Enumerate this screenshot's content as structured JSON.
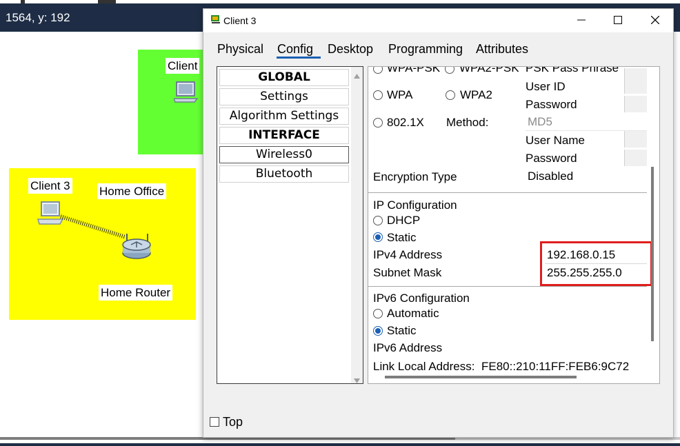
{
  "workspace": {
    "coords": "1564, y: 192",
    "labels": {
      "client_partial": "Client",
      "client3": "Client 3",
      "home_office": "Home Office",
      "home_router": "Home Router"
    },
    "colors": {
      "green_area": "#64ff33",
      "yellow_area": "#ffff00",
      "topbar": "#1e2d45"
    }
  },
  "dialog": {
    "title": "Client 3",
    "window_buttons": [
      "minimize-icon",
      "maximize-icon",
      "close-icon"
    ],
    "tabs": [
      {
        "label": "Physical",
        "active": false
      },
      {
        "label": "Config",
        "active": true
      },
      {
        "label": "Desktop",
        "active": false
      },
      {
        "label": "Programming",
        "active": false
      },
      {
        "label": "Attributes",
        "active": false
      }
    ],
    "nav": [
      {
        "label": "GLOBAL",
        "header": true
      },
      {
        "label": "Settings",
        "header": false
      },
      {
        "label": "Algorithm Settings",
        "header": false
      },
      {
        "label": "INTERFACE",
        "header": true
      },
      {
        "label": "Wireless0",
        "header": false,
        "selected": true
      },
      {
        "label": "Bluetooth",
        "header": false
      }
    ],
    "auth": {
      "wpa_psk": "WPA-PSK",
      "wpa2_psk": "WPA2-PSK",
      "psk_pass_phrase": "PSK Pass Phrase",
      "wpa": "WPA",
      "wpa2": "WPA2",
      "user_id_label": "User ID",
      "password_label": "Password",
      "dot1x": "802.1X",
      "method_label": "Method:",
      "method_value": "MD5",
      "user_name_label": "User Name",
      "password2_label": "Password"
    },
    "encryption": {
      "label": "Encryption Type",
      "value": "Disabled"
    },
    "ip_config": {
      "heading": "IP Configuration",
      "dhcp": "DHCP",
      "static": "Static",
      "mode": "Static",
      "ipv4_label": "IPv4 Address",
      "ipv4_value": "192.168.0.15",
      "mask_label": "Subnet Mask",
      "mask_value": "255.255.255.0"
    },
    "ipv6_config": {
      "heading": "IPv6 Configuration",
      "automatic": "Automatic",
      "static": "Static",
      "mode": "Static",
      "ipv6_label": "IPv6 Address",
      "ipv6_value": "",
      "link_local_label": "Link Local Address:",
      "link_local_value": "FE80::210:11FF:FEB6:9C72"
    },
    "top_checkbox": {
      "label": "Top",
      "checked": false
    },
    "highlight_color": "#e11d1d",
    "accent_color": "#1c5fb4"
  }
}
